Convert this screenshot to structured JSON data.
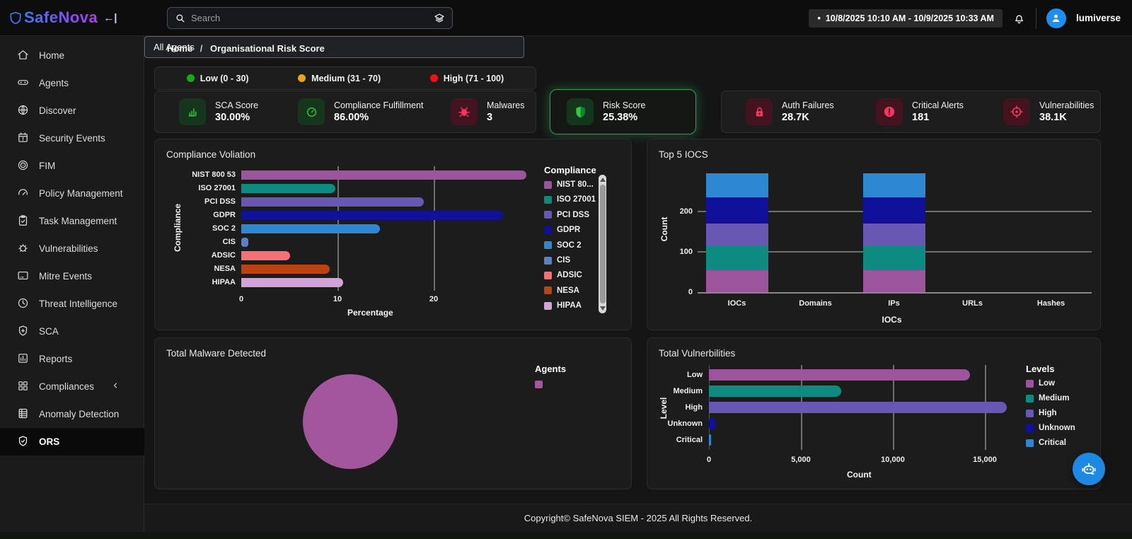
{
  "brand": {
    "name": "SafeNova",
    "collapse_glyph": "←|"
  },
  "topbar": {
    "search_placeholder": "Search",
    "bullet": "•",
    "date_range": "10/8/2025 10:10 AM - 10/9/2025 10:33 AM",
    "username": "lumiverse"
  },
  "breadcrumb": {
    "home": "Home",
    "separator": "/",
    "current": "Organisational Risk Score"
  },
  "sidebar": {
    "items": [
      {
        "label": "Home",
        "icon": "home-icon"
      },
      {
        "label": "Agents",
        "icon": "agents-icon"
      },
      {
        "label": "Discover",
        "icon": "discover-icon"
      },
      {
        "label": "Security Events",
        "icon": "security-events-icon"
      },
      {
        "label": "FIM",
        "icon": "fim-icon"
      },
      {
        "label": "Policy Management",
        "icon": "policy-management-icon"
      },
      {
        "label": "Task Management",
        "icon": "task-management-icon"
      },
      {
        "label": "Vulnerabilities",
        "icon": "vulnerabilities-icon"
      },
      {
        "label": "Mitre Events",
        "icon": "mitre-events-icon"
      },
      {
        "label": "Threat Intelligence",
        "icon": "threat-intelligence-icon"
      },
      {
        "label": "SCA",
        "icon": "sca-icon"
      },
      {
        "label": "Reports",
        "icon": "reports-icon"
      },
      {
        "label": "Compliances",
        "icon": "compliances-icon",
        "has_submenu": true
      },
      {
        "label": "Anomaly Detection",
        "icon": "anomaly-detection-icon"
      },
      {
        "label": "ORS",
        "icon": "ors-icon",
        "active": true
      }
    ]
  },
  "risk_bands": [
    {
      "label": "Low (0 - 30)",
      "color": "#18a81c"
    },
    {
      "label": "Medium (31 - 70)",
      "color": "#f2a30b"
    },
    {
      "label": "High (71 - 100)",
      "color": "#f50f0f"
    }
  ],
  "agents_filter": {
    "value": "All Agents"
  },
  "metrics": {
    "left": [
      {
        "label": "SCA Score",
        "value": "30.00%",
        "icon": "bar-chart-icon",
        "tone": "green"
      },
      {
        "label": "Compliance Fulfillment",
        "value": "86.00%",
        "icon": "gauge-icon",
        "tone": "green"
      },
      {
        "label": "Malwares",
        "value": "3",
        "icon": "bug-icon",
        "tone": "red"
      }
    ],
    "risk": {
      "label": "Risk Score",
      "value": "25.38%",
      "icon": "shield-icon",
      "tone": "green"
    },
    "right": [
      {
        "label": "Auth Failures",
        "value": "28.7K",
        "icon": "lock-icon",
        "tone": "red"
      },
      {
        "label": "Critical Alerts",
        "value": "181",
        "icon": "alert-circle-icon",
        "tone": "red"
      },
      {
        "label": "Vulnerabilities",
        "value": "38.1K",
        "icon": "crosshair-icon",
        "tone": "red"
      }
    ]
  },
  "chart_data": [
    {
      "id": "compliance-violation",
      "type": "bar",
      "orientation": "horizontal",
      "title": "Compliance Voliation",
      "xlabel": "Percentage",
      "ylabel": "Compliance",
      "xticks": [
        0,
        10,
        20
      ],
      "xlim": [
        0,
        30
      ],
      "categories": [
        "NIST 800 53",
        "ISO 27001",
        "PCI DSS",
        "GDPR",
        "SOC 2",
        "CIS",
        "ADSIC",
        "NESA",
        "HIPAA"
      ],
      "values": [
        29.6,
        9.8,
        19.0,
        27.2,
        14.4,
        0.7,
        5.1,
        9.2,
        10.6
      ],
      "colors": [
        "#9c549c",
        "#0e8b80",
        "#6857b3",
        "#10109a",
        "#2e87d2",
        "#5c80c3",
        "#f57078",
        "#bc4310",
        "#d2a3d8"
      ],
      "legend": {
        "title": "Compliance",
        "labels": [
          "NIST 80...",
          "ISO 27001",
          "PCI DSS",
          "GDPR",
          "SOC 2",
          "CIS",
          "ADSIC",
          "NESA",
          "HIPAA"
        ],
        "scrollbar": true
      }
    },
    {
      "id": "top-5-iocs",
      "type": "bar",
      "subtype": "stacked-column",
      "title": "Top 5 IOCS",
      "xlabel": "IOCs",
      "ylabel": "Count",
      "yticks": [
        0,
        100,
        200
      ],
      "ylim": [
        0,
        310
      ],
      "categories": [
        "IOCs",
        "Domains",
        "IPs",
        "URLs",
        "Hashes"
      ],
      "series": [
        {
          "color": "#9c549c",
          "values": [
            55,
            0,
            55,
            0,
            0
          ]
        },
        {
          "color": "#0e8b80",
          "values": [
            60,
            0,
            60,
            0,
            0
          ]
        },
        {
          "color": "#6857b3",
          "values": [
            55,
            0,
            55,
            0,
            0
          ]
        },
        {
          "color": "#10109a",
          "values": [
            65,
            0,
            65,
            0,
            0
          ]
        },
        {
          "color": "#2e87d2",
          "values": [
            60,
            0,
            60,
            0,
            0
          ]
        }
      ]
    },
    {
      "id": "total-malware-detected",
      "type": "pie",
      "title": "Total Malware Detected",
      "slices": [
        {
          "value": 100,
          "color": "#a4569d"
        }
      ],
      "legend": {
        "title": "Agents",
        "labels": [
          ""
        ],
        "colors": [
          "#a4569d"
        ]
      }
    },
    {
      "id": "total-vulnerabilities",
      "type": "bar",
      "orientation": "horizontal",
      "title": "Total Vulnerbilities",
      "xlabel": "Count",
      "ylabel": "Level",
      "xticks": [
        0,
        5000,
        10000,
        15000
      ],
      "xtick_labels": [
        "0",
        "5,000",
        "10,000",
        "15,000"
      ],
      "xlim": [
        0,
        16600
      ],
      "categories": [
        "Low",
        "Medium",
        "High",
        "Unknown",
        "Critical"
      ],
      "values": [
        14200,
        7200,
        16200,
        350,
        120
      ],
      "colors": [
        "#9c549c",
        "#0e8b80",
        "#6857b3",
        "#10109a",
        "#2e87d2"
      ],
      "legend": {
        "title": "Levels",
        "labels": [
          "Low",
          "Medium",
          "High",
          "Unknown",
          "Critical"
        ]
      }
    }
  ],
  "footer": {
    "copyright": "Copyright© SafeNova SIEM - 2025 All Rights Reserved."
  },
  "colors": {
    "accent_blue": "#1e88e5",
    "sidebar_active_bg": "#0a0a0a",
    "pie_purple": "#a4569d"
  }
}
